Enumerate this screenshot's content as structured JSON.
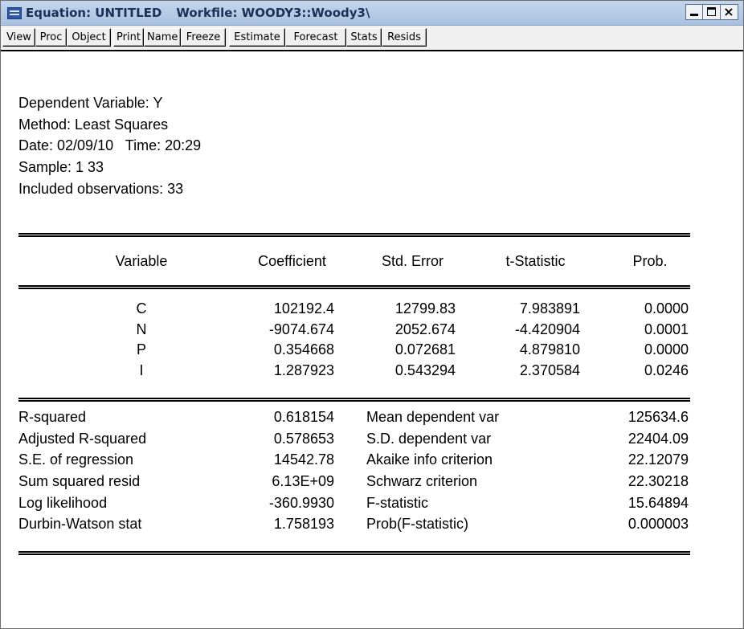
{
  "window": {
    "title_equation": "Equation: UNTITLED",
    "title_workfile": "Workfile: WOODY3::Woody3\\"
  },
  "toolbar": {
    "buttons": [
      "View",
      "Proc",
      "Object",
      "Print",
      "Name",
      "Freeze",
      "Estimate",
      "Forecast",
      "Stats",
      "Resids"
    ]
  },
  "header": {
    "dependent": "Dependent Variable: Y",
    "method": "Method: Least Squares",
    "datetime": "Date: 02/09/10   Time: 20:29",
    "sample": "Sample: 1 33",
    "included": "Included observations: 33"
  },
  "coef_table": {
    "columns": [
      "Variable",
      "Coefficient",
      "Std. Error",
      "t-Statistic",
      "Prob."
    ],
    "rows": [
      [
        "C",
        "102192.4",
        "12799.83",
        "7.983891",
        "0.0000"
      ],
      [
        "N",
        "-9074.674",
        "2052.674",
        "-4.420904",
        "0.0001"
      ],
      [
        "P",
        "0.354668",
        "0.072681",
        "4.879810",
        "0.0000"
      ],
      [
        "I",
        "1.287923",
        "0.543294",
        "2.370584",
        "0.0246"
      ]
    ]
  },
  "stats": {
    "rows": [
      [
        "R-squared",
        "0.618154",
        "Mean dependent var",
        "125634.6"
      ],
      [
        "Adjusted R-squared",
        "0.578653",
        "S.D. dependent var",
        "22404.09"
      ],
      [
        "S.E. of regression",
        "14542.78",
        "Akaike info criterion",
        "22.12079"
      ],
      [
        "Sum squared resid",
        "6.13E+09",
        "Schwarz criterion",
        "22.30218"
      ],
      [
        "Log likelihood",
        "-360.9930",
        "F-statistic",
        "15.64894"
      ],
      [
        "Durbin-Watson stat",
        "1.758193",
        "Prob(F-statistic)",
        "0.000003"
      ]
    ]
  }
}
